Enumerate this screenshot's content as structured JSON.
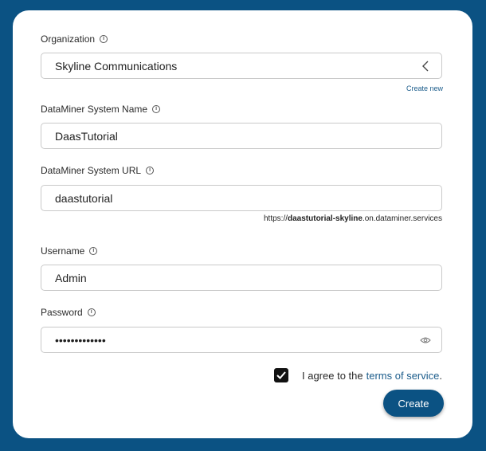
{
  "form": {
    "organization": {
      "label": "Organization",
      "value": "Skyline Communications",
      "create_new": "Create new"
    },
    "system_name": {
      "label": "DataMiner System Name",
      "value": "DaasTutorial"
    },
    "system_url": {
      "label": "DataMiner System URL",
      "value": "daastutorial",
      "hint_prefix": "https://",
      "hint_bold": "daastutorial-skyline",
      "hint_suffix": ".on.dataminer.services"
    },
    "username": {
      "label": "Username",
      "value": "Admin"
    },
    "password": {
      "label": "Password",
      "value": "•••••••••••••"
    },
    "terms": {
      "prefix": "I agree to the",
      "link": "terms of service",
      "suffix": "."
    },
    "create_label": "Create"
  },
  "colors": {
    "background": "#0b5283",
    "accent": "#0b5283",
    "link": "#1b5c8b"
  },
  "icons": [
    "info-icon",
    "chevron-left-icon",
    "eye-icon",
    "checkmark-icon"
  ]
}
